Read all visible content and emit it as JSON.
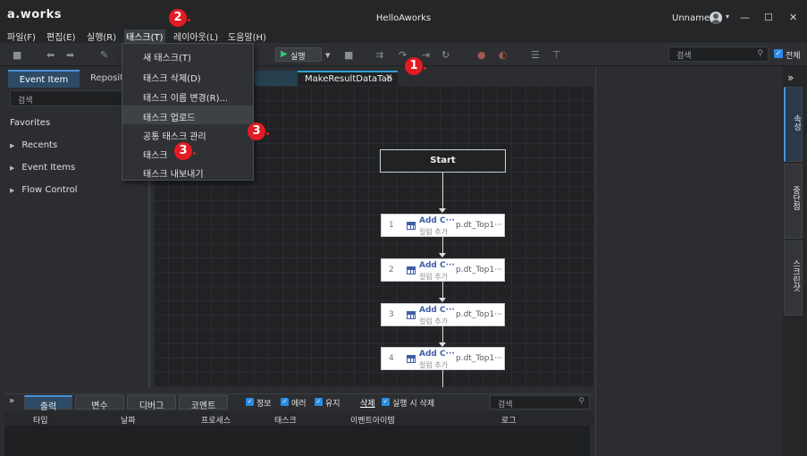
{
  "app": {
    "logo": "a.works",
    "title": "HelloAworks",
    "user": "Unnamed",
    "window_controls": [
      "minimize-icon",
      "maximize-icon",
      "close-icon"
    ]
  },
  "menu": {
    "items": [
      "파일(F)",
      "편집(E)",
      "실행(R)",
      "태스크(T)",
      "레이아웃(L)",
      "도움말(H)"
    ],
    "active": "태스크(T)"
  },
  "toolbar": {
    "run_label": "실행",
    "search_placeholder": "검색",
    "all_checkbox_label": "전체",
    "all_checked": true
  },
  "task_menu": {
    "items": [
      "새 태스크(T)",
      "태스크 삭제(D)",
      "태스크 이름 변경(R)...",
      "태스크 업로드",
      "공통 태스크 관리",
      "태스크 가져오기",
      "태스크 내보내기"
    ],
    "item_6_visible": "태스크",
    "hovered": "태스크 업로드"
  },
  "left_panel": {
    "tabs": [
      "Event Item",
      "Reposit"
    ],
    "active_tab": "Event Item",
    "search_placeholder": "검색",
    "section": "Favorites",
    "tree": [
      "Recents",
      "Event Items",
      "Flow Control"
    ]
  },
  "editor": {
    "active_tab": "MakeResultDataTab",
    "start_label": "Start",
    "steps": [
      {
        "num": "1",
        "title": "Add C···",
        "sub": "컬럼 추가",
        "param": "p.dt_Top1···"
      },
      {
        "num": "2",
        "title": "Add C···",
        "sub": "컬럼 추가",
        "param": "p.dt_Top1···"
      },
      {
        "num": "3",
        "title": "Add C···",
        "sub": "컬럼 추가",
        "param": "p.dt_Top1···"
      },
      {
        "num": "4",
        "title": "Add C···",
        "sub": "컬럼 추가",
        "param": "p.dt_Top1···"
      }
    ]
  },
  "right_strip": {
    "tabs": [
      "속성",
      "중단점",
      "스크린샷"
    ],
    "active": "속성"
  },
  "bottom_panel": {
    "tabs": [
      "출력",
      "변수",
      "디버그",
      "코멘트"
    ],
    "active_tab": "출력",
    "filters": [
      {
        "label": "정보",
        "checked": true
      },
      {
        "label": "에러",
        "checked": true
      },
      {
        "label": "유지",
        "checked": true
      }
    ],
    "delete_label": "삭제",
    "delete_on_run_label": "실행 시 삭제",
    "search_placeholder": "검색",
    "columns": [
      "타입",
      "날짜",
      "프로세스",
      "태스크",
      "이벤트아이템",
      "로그"
    ]
  },
  "annotations": [
    "1",
    "2",
    "3",
    "3"
  ],
  "colors": {
    "accent": "#2a8be4",
    "annotation": "#e31b23",
    "run_play": "#31c37a",
    "step_title": "#3f5fa7"
  }
}
